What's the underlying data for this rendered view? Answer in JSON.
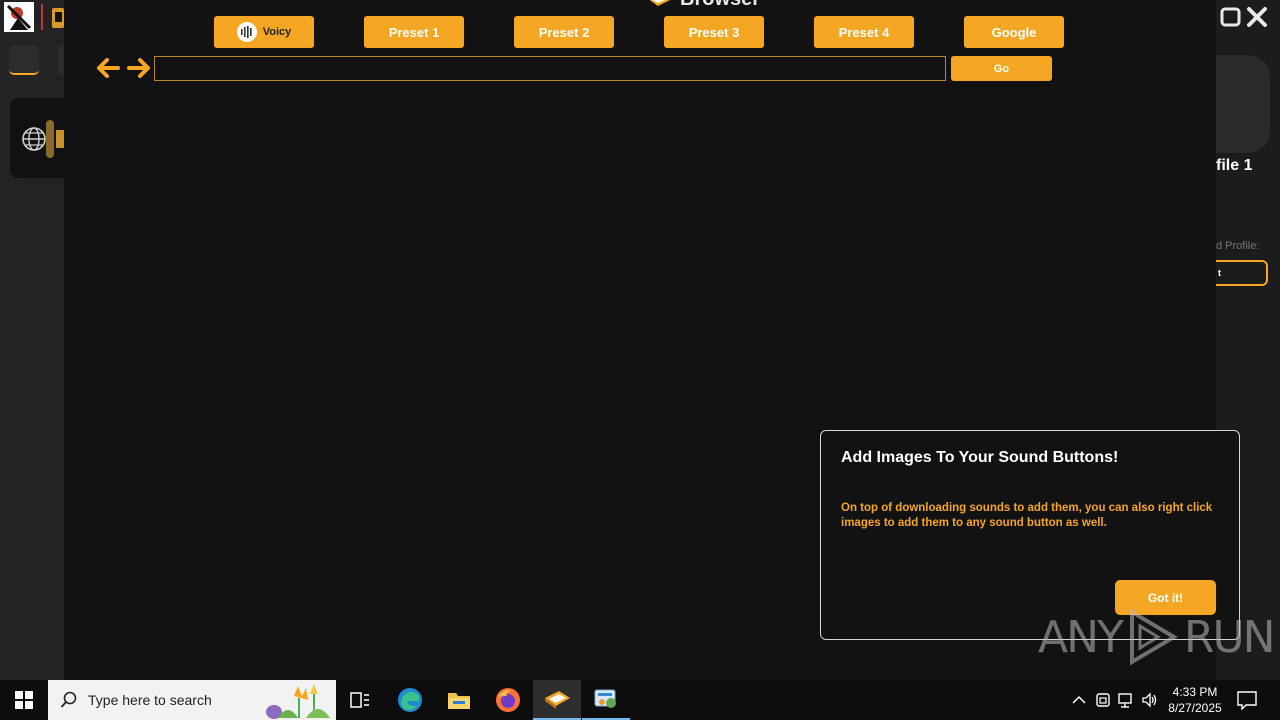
{
  "app": {
    "brand": "Browser",
    "side_profile": "file 1",
    "side_profile_label": "d Profile:",
    "side_select_value": "t"
  },
  "presets": [
    {
      "label": "Voicy",
      "icon": "voicy-waveform-icon"
    },
    {
      "label": "Preset 1"
    },
    {
      "label": "Preset 2"
    },
    {
      "label": "Preset 3"
    },
    {
      "label": "Preset 4"
    },
    {
      "label": "Google"
    }
  ],
  "navbar": {
    "url_value": "",
    "go_label": "Go"
  },
  "tip": {
    "title": "Add Images To Your Sound Buttons!",
    "body": "On top of downloading sounds to add them, you can also right click images to add them to any sound button as well.",
    "button_label": "Got it!"
  },
  "watermark": {
    "text_left": "ANY",
    "text_right": "RUN"
  },
  "taskbar": {
    "search_placeholder": "Type here to search",
    "apps": [
      "task-view-icon",
      "edge-icon",
      "file-explorer-icon",
      "firefox-icon",
      "voicemod-soundboard-icon",
      "control-panel-icon"
    ],
    "time": "4:33 PM",
    "date": "8/27/2025"
  },
  "colors": {
    "accent": "#f5a623",
    "background": "#121212",
    "text": "#ffffff"
  }
}
